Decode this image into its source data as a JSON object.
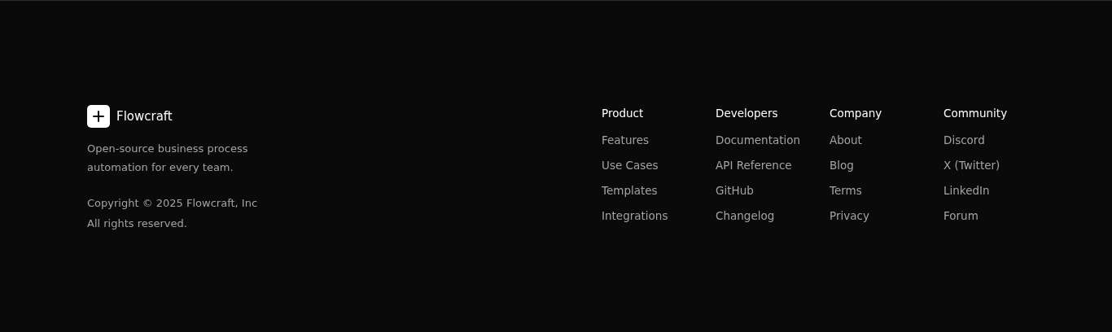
{
  "brand": {
    "name": "Flowcraft",
    "tagline": "Open-source business process automation for every team.",
    "copyright": "Copyright © 2025 Flowcraft, Inc",
    "rights": "All rights reserved."
  },
  "columns": [
    {
      "heading": "Product",
      "links": [
        "Features",
        "Use Cases",
        "Templates",
        "Integrations"
      ]
    },
    {
      "heading": "Developers",
      "links": [
        "Documentation",
        "API Reference",
        "GitHub",
        "Changelog"
      ]
    },
    {
      "heading": "Company",
      "links": [
        "About",
        "Blog",
        "Terms",
        "Privacy"
      ]
    },
    {
      "heading": "Community",
      "links": [
        "Discord",
        "X (Twitter)",
        "LinkedIn",
        "Forum"
      ]
    }
  ]
}
